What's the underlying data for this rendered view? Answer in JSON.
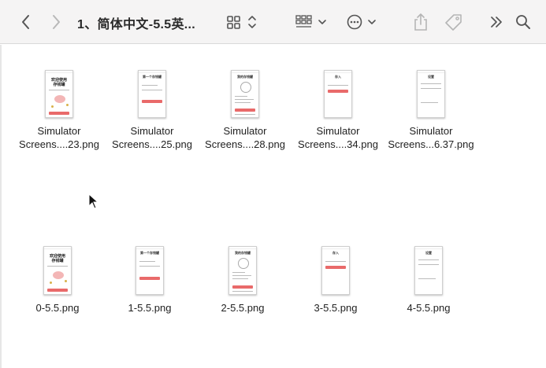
{
  "window": {
    "title": "1、简体中文-5.5英..."
  },
  "toolbar": {
    "back": "chevron-left-icon",
    "forward": "chevron-right-icon",
    "view": "grid-view-icon",
    "group": "group-icon",
    "more": "ellipsis-icon",
    "share": "share-icon",
    "tag": "tag-icon",
    "overflow": "double-chevron-icon",
    "search": "search-icon"
  },
  "files": [
    {
      "l1": "Simulator",
      "l2": "Screens....23.png"
    },
    {
      "l1": "Simulator",
      "l2": "Screens....25.png"
    },
    {
      "l1": "Simulator",
      "l2": "Screens....28.png"
    },
    {
      "l1": "Simulator",
      "l2": "Screens....34.png"
    },
    {
      "l1": "Simulator",
      "l2": "Screens...6.37.png"
    },
    {
      "l1": "0-5.5.png",
      "l2": ""
    },
    {
      "l1": "1-5.5.png",
      "l2": ""
    },
    {
      "l1": "2-5.5.png",
      "l2": ""
    },
    {
      "l1": "3-5.5.png",
      "l2": ""
    },
    {
      "l1": "4-5.5.png",
      "l2": ""
    }
  ],
  "thumbs": {
    "welcome": "欢迎使用\n存钱罐",
    "first": "第一个存钱罐",
    "mine": "我的存钱罐",
    "deposit": "存入",
    "settings": "设置"
  },
  "colors": {
    "accent": "#e96a6a",
    "toolbar_bg": "#f5f4f4"
  }
}
